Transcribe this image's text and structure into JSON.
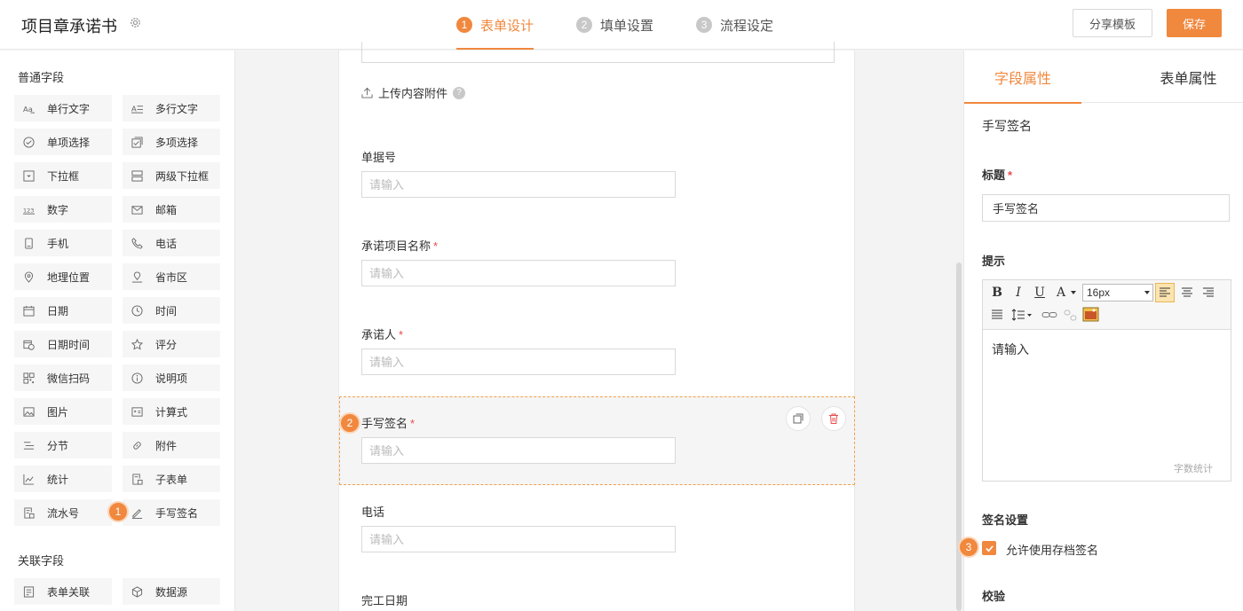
{
  "header": {
    "title": "项目章承诺书",
    "steps": [
      {
        "num": "1",
        "label": "表单设计"
      },
      {
        "num": "2",
        "label": "填单设置"
      },
      {
        "num": "3",
        "label": "流程设定"
      }
    ],
    "share_label": "分享模板",
    "save_label": "保存"
  },
  "left": {
    "common_title": "普通字段",
    "fields": [
      "单行文字",
      "多行文字",
      "单项选择",
      "多项选择",
      "下拉框",
      "两级下拉框",
      "数字",
      "邮箱",
      "手机",
      "电话",
      "地理位置",
      "省市区",
      "日期",
      "时间",
      "日期时间",
      "评分",
      "微信扫码",
      "说明项",
      "图片",
      "计算式",
      "分节",
      "附件",
      "统计",
      "子表单",
      "流水号",
      "手写签名"
    ],
    "related_title": "关联字段",
    "related_fields": [
      "表单关联",
      "数据源"
    ]
  },
  "canvas": {
    "upload_label": "上传内容附件",
    "help": "?",
    "placeholder": "请输入",
    "fields": [
      {
        "label": "单据号",
        "required": ""
      },
      {
        "label": "承诺项目名称",
        "required": "*"
      },
      {
        "label": "承诺人",
        "required": "*"
      },
      {
        "label": "手写签名",
        "required": "*"
      },
      {
        "label": "电话",
        "required": ""
      },
      {
        "label": "完工日期",
        "required": ""
      }
    ]
  },
  "badges": [
    "1",
    "2",
    "3"
  ],
  "right": {
    "tabs": [
      "字段属性",
      "表单属性"
    ],
    "field_type": "手写签名",
    "title_label": "标题",
    "title_required": "*",
    "title_value": "手写签名",
    "hint_label": "提示",
    "toolbar": {
      "bold": "B",
      "italic": "I",
      "underline": "U",
      "color": "A",
      "font_size": "16px"
    },
    "hint_placeholder": "请输入",
    "word_count": "字数统计",
    "signature_settings": "签名设置",
    "allow_archive": "允许使用存档签名",
    "validation": "校验"
  },
  "colors": {
    "accent": "#f0883e",
    "required": "#e94b4b"
  }
}
